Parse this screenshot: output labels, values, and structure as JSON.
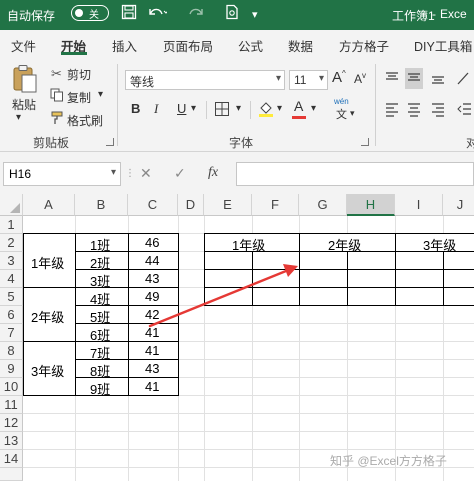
{
  "titlebar": {
    "autosave_label": "自动保存",
    "toggle_state": "关",
    "workbook_name": "工作簿1",
    "dash": "-",
    "app_name": "Exce"
  },
  "ribbon_tabs": [
    "文件",
    "开始",
    "插入",
    "页面布局",
    "公式",
    "数据",
    "方方格子",
    "DIY工具箱"
  ],
  "clipboard": {
    "paste": "粘贴",
    "cut": "剪切",
    "copy": "复制",
    "format_painter": "格式刷",
    "group_label": "剪贴板"
  },
  "font": {
    "font_name": "等线",
    "font_size": "11",
    "grow": "A",
    "shrink": "A",
    "bold": "B",
    "italic": "I",
    "underline": "U",
    "font_color_letter": "A",
    "wen": "wén",
    "wen_char": "文",
    "group_label": "字体"
  },
  "alignment": {
    "group_label_partial": "对"
  },
  "formula_bar": {
    "name_box": "H16",
    "fx": "fx",
    "cancel": "✕",
    "enter": "✓"
  },
  "columns": [
    "A",
    "B",
    "C",
    "D",
    "E",
    "F",
    "G",
    "H",
    "I",
    "J"
  ],
  "selected_column": "H",
  "rows": [
    "1",
    "2",
    "3",
    "4",
    "5",
    "6",
    "7",
    "8",
    "9",
    "10",
    "11",
    "12",
    "13",
    "14"
  ],
  "cells": {
    "grade1": "1年级",
    "grade2": "2年级",
    "grade3": "3年级",
    "class1": "1班",
    "class2": "2班",
    "class3": "3班",
    "class4": "4班",
    "class5": "5班",
    "class6": "6班",
    "class7": "7班",
    "class8": "8班",
    "class9": "9班",
    "v1": "46",
    "v2": "44",
    "v3": "43",
    "v4": "49",
    "v5": "42",
    "v6": "41",
    "v7": "41",
    "v8": "43",
    "v9": "41",
    "hdr1": "1年级",
    "hdr2": "2年级",
    "hdr3": "3年级"
  },
  "annotation_color": "#e53935",
  "watermark": "知乎 @Excel方方格子"
}
